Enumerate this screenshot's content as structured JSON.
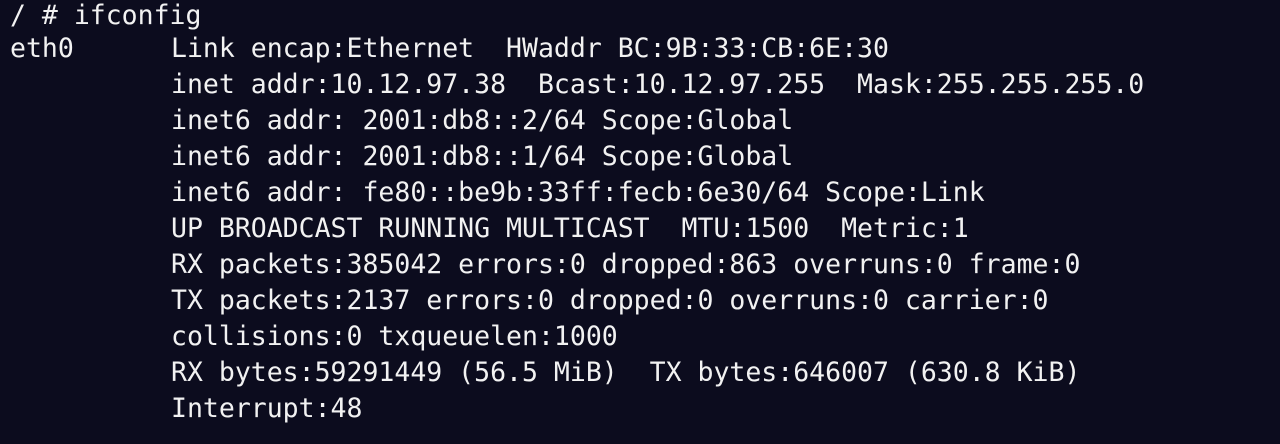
{
  "terminal": {
    "prompt_command": "/ # ifconfig",
    "interface": {
      "name": "eth0",
      "lines": [
        "Link encap:Ethernet  HWaddr BC:9B:33:CB:6E:30",
        "inet addr:10.12.97.38  Bcast:10.12.97.255  Mask:255.255.255.0",
        "inet6 addr: 2001:db8::2/64 Scope:Global",
        "inet6 addr: 2001:db8::1/64 Scope:Global",
        "inet6 addr: fe80::be9b:33ff:fecb:6e30/64 Scope:Link",
        "UP BROADCAST RUNNING MULTICAST  MTU:1500  Metric:1",
        "RX packets:385042 errors:0 dropped:863 overruns:0 frame:0",
        "TX packets:2137 errors:0 dropped:0 overruns:0 carrier:0",
        "collisions:0 txqueuelen:1000",
        "RX bytes:59291449 (56.5 MiB)  TX bytes:646007 (630.8 KiB)",
        "Interrupt:48"
      ]
    },
    "colors": {
      "background": "#0c0c1e",
      "foreground": "#f2f2f2"
    }
  }
}
